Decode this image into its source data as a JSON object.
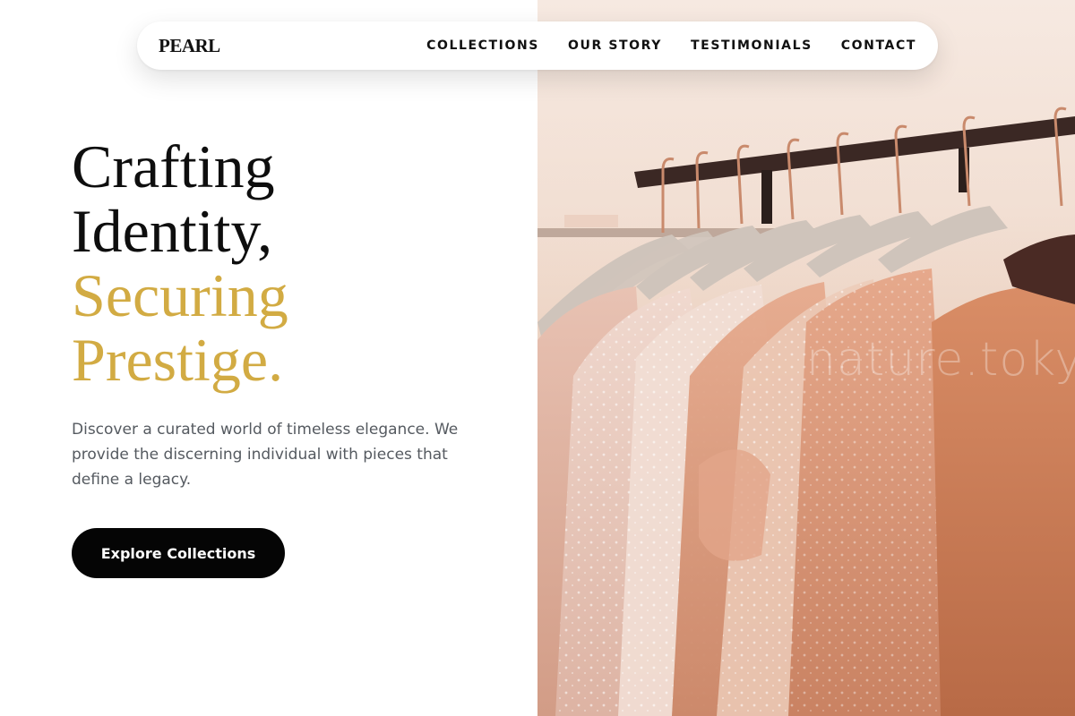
{
  "brand": {
    "logo": "PEARL"
  },
  "nav": {
    "links": [
      "COLLECTIONS",
      "OUR STORY",
      "TESTIMONIALS",
      "CONTACT"
    ]
  },
  "hero": {
    "line1": "Crafting",
    "line2": "Identity,",
    "line3": "Securing",
    "line4": "Prestige.",
    "description": "Discover a curated world of timeless elegance. We provide the discerning individual with pieces that define a legacy.",
    "cta_label": "Explore Collections"
  },
  "photo": {
    "watermark": "nature.tokyo"
  },
  "colors": {
    "accent_gold": "#d2ab43",
    "text_dark": "#0e0e0e",
    "body_text": "#555a60",
    "button_bg": "#050505"
  }
}
